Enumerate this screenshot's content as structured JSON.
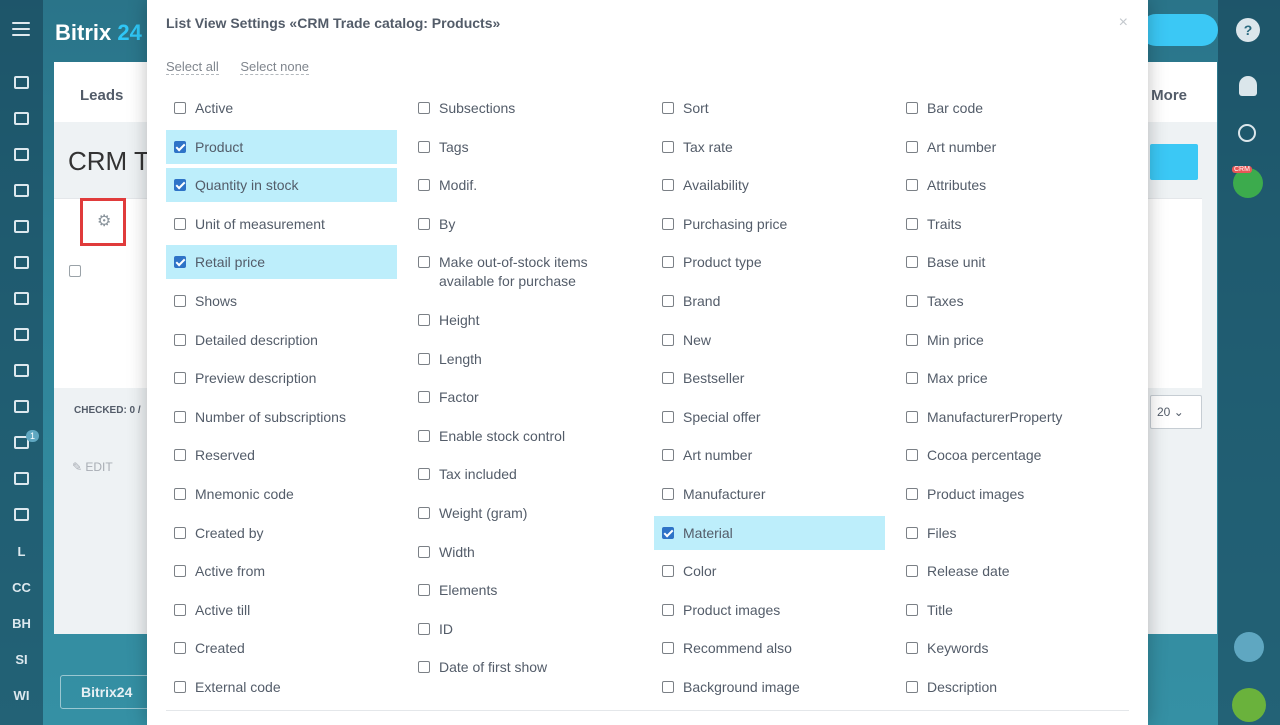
{
  "background": {
    "logo_text": "Bitrix",
    "logo_num": "24",
    "tab_leads": "Leads",
    "tab_more": "More",
    "page_title": "CRM Tr",
    "checked_label": "CHECKED: 0 /",
    "pager_value": "20",
    "edit_label": "EDIT",
    "bottom_tab": "Bitrix24",
    "left_nav": [
      "L",
      "CC",
      "BH",
      "SI",
      "WI"
    ],
    "counter_badge": "1",
    "crm_badge": "CRM",
    "help_icon": "?"
  },
  "dialog": {
    "title": "List View Settings «CRM Trade catalog: Products»",
    "close": "×",
    "select_all": "Select all",
    "select_none": "Select none",
    "columns": [
      [
        {
          "label": "Active",
          "checked": false
        },
        {
          "label": "Product",
          "checked": true
        },
        {
          "label": "Quantity in stock",
          "checked": true
        },
        {
          "label": "Unit of measurement",
          "checked": false
        },
        {
          "label": "Retail price",
          "checked": true
        },
        {
          "label": "Shows",
          "checked": false
        },
        {
          "label": "Detailed description",
          "checked": false
        },
        {
          "label": "Preview description",
          "checked": false
        },
        {
          "label": "Number of subscriptions",
          "checked": false
        },
        {
          "label": "Reserved",
          "checked": false
        },
        {
          "label": "Mnemonic code",
          "checked": false
        },
        {
          "label": "Created by",
          "checked": false
        },
        {
          "label": "Active from",
          "checked": false
        },
        {
          "label": "Active till",
          "checked": false
        },
        {
          "label": "Created",
          "checked": false
        },
        {
          "label": "External code",
          "checked": false
        }
      ],
      [
        {
          "label": "Subsections",
          "checked": false
        },
        {
          "label": "Tags",
          "checked": false
        },
        {
          "label": "Modif.",
          "checked": false
        },
        {
          "label": "By",
          "checked": false
        },
        {
          "label": "Make out-of-stock items available for purchase",
          "checked": false
        },
        {
          "label": "Height",
          "checked": false
        },
        {
          "label": "Length",
          "checked": false
        },
        {
          "label": "Factor",
          "checked": false
        },
        {
          "label": "Enable stock control",
          "checked": false
        },
        {
          "label": "Tax included",
          "checked": false
        },
        {
          "label": "Weight (gram)",
          "checked": false
        },
        {
          "label": "Width",
          "checked": false
        },
        {
          "label": "Elements",
          "checked": false
        },
        {
          "label": "ID",
          "checked": false
        },
        {
          "label": "Date of first show",
          "checked": false
        }
      ],
      [
        {
          "label": "Sort",
          "checked": false
        },
        {
          "label": "Tax rate",
          "checked": false
        },
        {
          "label": "Availability",
          "checked": false
        },
        {
          "label": "Purchasing price",
          "checked": false
        },
        {
          "label": "Product type",
          "checked": false
        },
        {
          "label": "Brand",
          "checked": false
        },
        {
          "label": "New",
          "checked": false
        },
        {
          "label": "Bestseller",
          "checked": false
        },
        {
          "label": "Special offer",
          "checked": false
        },
        {
          "label": "Art number",
          "checked": false
        },
        {
          "label": "Manufacturer",
          "checked": false
        },
        {
          "label": "Material",
          "checked": true
        },
        {
          "label": "Color",
          "checked": false
        },
        {
          "label": "Product images",
          "checked": false
        },
        {
          "label": "Recommend also",
          "checked": false
        },
        {
          "label": "Background image",
          "checked": false
        }
      ],
      [
        {
          "label": "Bar code",
          "checked": false
        },
        {
          "label": "Art number",
          "checked": false
        },
        {
          "label": "Attributes",
          "checked": false
        },
        {
          "label": "Traits",
          "checked": false
        },
        {
          "label": "Base unit",
          "checked": false
        },
        {
          "label": "Taxes",
          "checked": false
        },
        {
          "label": "Min price",
          "checked": false
        },
        {
          "label": "Max price",
          "checked": false
        },
        {
          "label": "ManufacturerProperty",
          "checked": false
        },
        {
          "label": "Cocoa percentage",
          "checked": false
        },
        {
          "label": "Product images",
          "checked": false
        },
        {
          "label": "Files",
          "checked": false
        },
        {
          "label": "Release date",
          "checked": false
        },
        {
          "label": "Title",
          "checked": false
        },
        {
          "label": "Keywords",
          "checked": false
        },
        {
          "label": "Description",
          "checked": false
        }
      ]
    ]
  }
}
